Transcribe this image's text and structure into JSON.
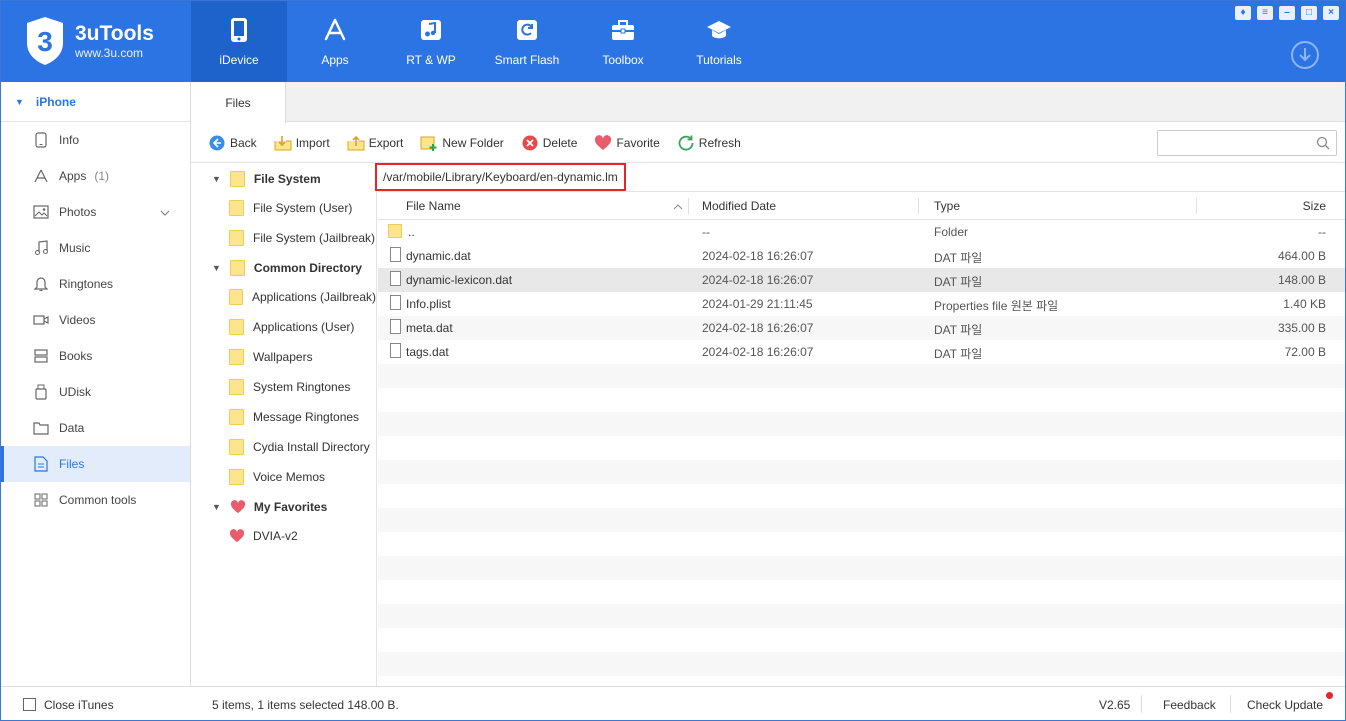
{
  "app": {
    "name": "3uTools",
    "url": "www.3u.com",
    "logo_mark": "3"
  },
  "nav": [
    {
      "label": "iDevice",
      "icon": "phone-icon",
      "active": true
    },
    {
      "label": "Apps",
      "icon": "app-store-icon"
    },
    {
      "label": "RT & WP",
      "icon": "music-note-icon"
    },
    {
      "label": "Smart Flash",
      "icon": "refresh-box-icon"
    },
    {
      "label": "Toolbox",
      "icon": "toolbox-icon"
    },
    {
      "label": "Tutorials",
      "icon": "graduation-cap-icon"
    }
  ],
  "sidebar": {
    "device": "iPhone",
    "items": [
      {
        "label": "Info",
        "icon": "phone-outline-icon"
      },
      {
        "label": "Apps",
        "count": "(1)",
        "icon": "app-store-outline-icon"
      },
      {
        "label": "Photos",
        "icon": "photo-icon"
      },
      {
        "label": "Music",
        "icon": "music-icon"
      },
      {
        "label": "Ringtones",
        "icon": "bell-icon"
      },
      {
        "label": "Videos",
        "icon": "video-icon"
      },
      {
        "label": "Books",
        "icon": "books-icon"
      },
      {
        "label": "UDisk",
        "icon": "udisk-icon"
      },
      {
        "label": "Data",
        "icon": "folder-icon"
      },
      {
        "label": "Files",
        "icon": "file-icon",
        "active": true
      },
      {
        "label": "Common tools",
        "icon": "grid-icon"
      }
    ]
  },
  "tabs": [
    "Files"
  ],
  "toolbar": {
    "back": "Back",
    "import": "Import",
    "export": "Export",
    "new_folder": "New Folder",
    "delete": "Delete",
    "favorite": "Favorite",
    "refresh": "Refresh",
    "search_value": ""
  },
  "tree": {
    "file_system": {
      "label": "File System",
      "children": [
        "File System (User)",
        "File System (Jailbreak)"
      ]
    },
    "common_directory": {
      "label": "Common Directory",
      "children": [
        "Applications (Jailbreak)",
        "Applications (User)",
        "Wallpapers",
        "System Ringtones",
        "Message Ringtones",
        "Cydia Install Directory",
        "Voice Memos"
      ]
    },
    "my_favorites": {
      "label": "My Favorites",
      "children": [
        "DVIA-v2"
      ]
    }
  },
  "path": "/var/mobile/Library/Keyboard/en-dynamic.lm",
  "table": {
    "columns": {
      "name": "File Name",
      "modified": "Modified Date",
      "type": "Type",
      "size": "Size"
    },
    "rows": [
      {
        "name": "..",
        "modified": "--",
        "type": "Folder",
        "size": "--",
        "kind": "folder"
      },
      {
        "name": "dynamic.dat",
        "modified": "2024-02-18 16:26:07",
        "type": "DAT 파일",
        "size": "464.00 B",
        "kind": "file"
      },
      {
        "name": "dynamic-lexicon.dat",
        "modified": "2024-02-18 16:26:07",
        "type": "DAT 파일",
        "size": "148.00 B",
        "kind": "file",
        "selected": true
      },
      {
        "name": "Info.plist",
        "modified": "2024-01-29 21:11:45",
        "type": "Properties file 원본 파일",
        "size": "1.40 KB",
        "kind": "file"
      },
      {
        "name": "meta.dat",
        "modified": "2024-02-18 16:26:07",
        "type": "DAT 파일",
        "size": "335.00 B",
        "kind": "file"
      },
      {
        "name": "tags.dat",
        "modified": "2024-02-18 16:26:07",
        "type": "DAT 파일",
        "size": "72.00 B",
        "kind": "file"
      }
    ]
  },
  "status": {
    "close_itunes": "Close iTunes",
    "info": "5 items, 1 items selected 148.00 B.",
    "version": "V2.65",
    "feedback": "Feedback",
    "check_update": "Check Update"
  },
  "colors": {
    "accent": "#2c74e4",
    "highlight": "#e8242a",
    "folder": "#fde58d"
  }
}
